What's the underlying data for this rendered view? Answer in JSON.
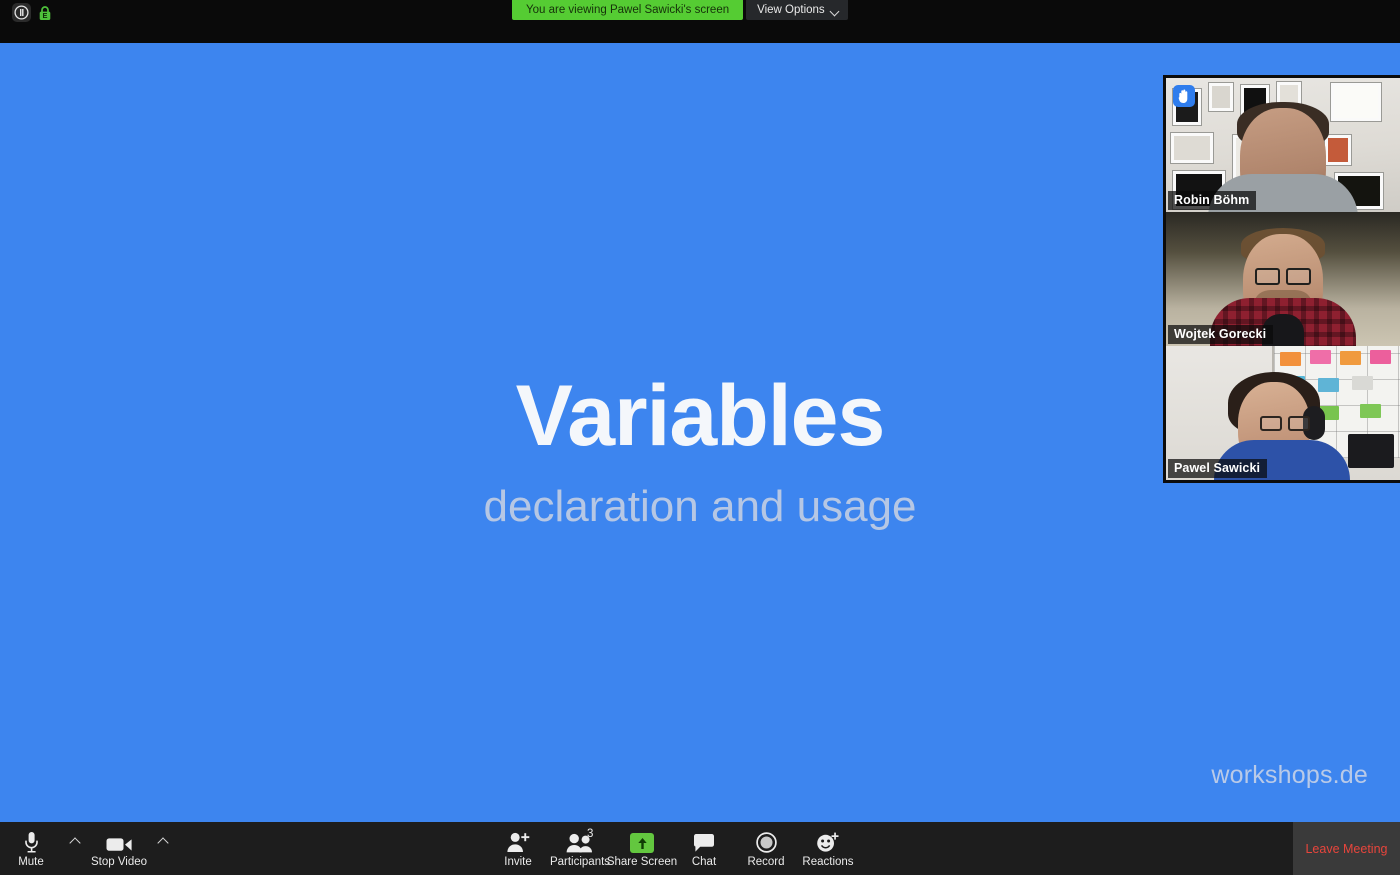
{
  "topbar": {
    "info_icon": "info-pause-icon",
    "encryption_icon": "green-lock-icon",
    "share_banner": "You are viewing Pawel Sawicki's screen",
    "view_options_label": "View Options",
    "view_options_chevron": "chevron-down-icon",
    "banner_color": "#55cc33",
    "lock_color": "#4ec13b"
  },
  "slide": {
    "title": "Variables",
    "subtitle": "declaration and usage",
    "watermark": "workshops.de",
    "background_color": "#3d85ef",
    "title_color": "#f4f7fb",
    "subtitle_color": "#b6c7e4"
  },
  "participants": [
    {
      "name": "Robin Böhm",
      "hand_raised": true,
      "hand_icon": "raised-hand-icon",
      "active_speaker": false
    },
    {
      "name": "Wojtek Gorecki",
      "hand_raised": false,
      "active_speaker": false
    },
    {
      "name": "Pawel Sawicki",
      "hand_raised": false,
      "active_speaker": true,
      "active_border_color": "#c9d84a"
    }
  ],
  "toolbar": {
    "mute": {
      "label": "Mute",
      "icon": "microphone-icon"
    },
    "audio_menu": {
      "icon": "chevron-up-icon"
    },
    "video": {
      "label": "Stop Video",
      "icon": "camera-icon"
    },
    "video_menu": {
      "icon": "chevron-up-icon"
    },
    "invite": {
      "label": "Invite",
      "icon": "add-person-icon"
    },
    "participants": {
      "label": "Participants",
      "icon": "people-icon",
      "count": "3"
    },
    "share_screen": {
      "label": "Share Screen",
      "icon": "up-arrow-icon",
      "color": "#63c73f"
    },
    "chat": {
      "label": "Chat",
      "icon": "speech-bubble-icon"
    },
    "record": {
      "label": "Record",
      "icon": "record-circle-icon"
    },
    "reactions": {
      "label": "Reactions",
      "icon": "smiley-plus-icon"
    },
    "leave": {
      "label": "Leave Meeting",
      "color": "#e8453c"
    }
  }
}
